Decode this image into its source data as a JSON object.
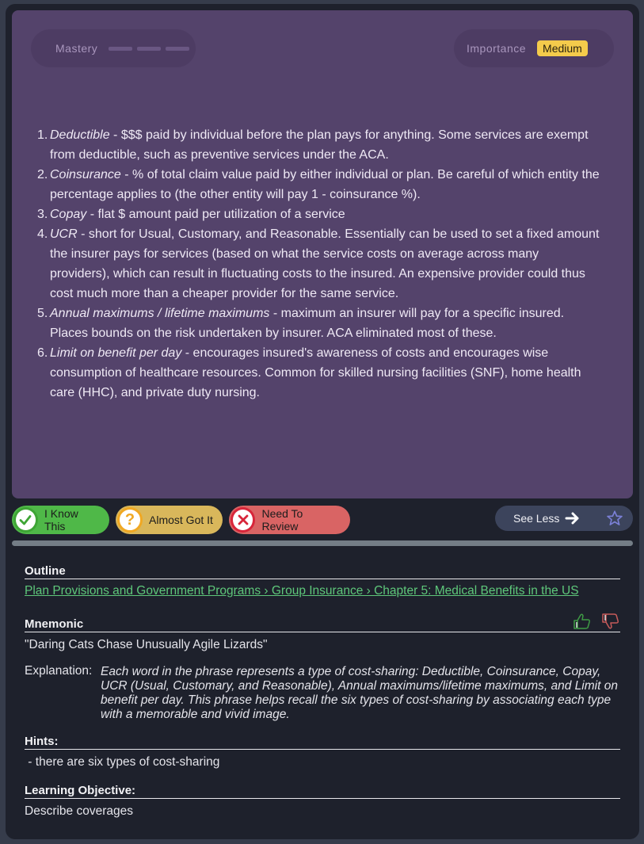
{
  "card": {
    "mastery_label": "Mastery",
    "mastery_level": 0,
    "mastery_segments": 3,
    "importance_label": "Importance",
    "importance_value": "Medium",
    "definitions": [
      {
        "term": "Deductible",
        "text": " - $$$ paid by individual before the plan pays for anything. Some services are exempt from deductible, such as preventive services under the ACA."
      },
      {
        "term": "Coinsurance",
        "text": " - % of total claim value paid by either individual or plan. Be careful of which entity the percentage applies to (the other entity will pay 1 - coinsurance %)."
      },
      {
        "term": "Copay",
        "text": " - flat $ amount paid per utilization of a service"
      },
      {
        "term": "UCR",
        "text": " - short for Usual, Customary, and Reasonable. Essentially can be used to set a fixed amount the insurer pays for services (based on what the service costs on average across many providers), which can result in fluctuating costs to the insured. An expensive provider could thus cost much more than a cheaper provider for the same service."
      },
      {
        "term": "Annual maximums / lifetime maximums",
        "text": " - maximum an insurer will pay for a specific insured. Places bounds on the risk undertaken by insurer. ACA eliminated most of these."
      },
      {
        "term": "Limit on benefit per day",
        "text": " - encourages insured's awareness of costs and encourages wise consumption of healthcare resources. Common for skilled nursing facilities (SNF), home health care (HHC), and private duty nursing."
      }
    ]
  },
  "actions": {
    "know_label": "I Know This",
    "know_icon": "check-icon",
    "almost_label": "Almost Got It",
    "almost_icon": "question-icon",
    "review_label": "Need To Review",
    "review_icon": "x-icon",
    "see_less_label": "See Less",
    "favorite_icon": "star-icon"
  },
  "colors": {
    "card_bg": "#54436b",
    "know": "#4fb848",
    "almost": "#d9b75b",
    "review": "#d96464",
    "importance_badge": "#f4cb4b",
    "link": "#5ec77a"
  },
  "details": {
    "outline_heading": "Outline",
    "outline_path": "Plan Provisions and Government Programs › Group Insurance › Chapter 5: Medical Benefits in the US",
    "mnemonic_heading": "Mnemonic",
    "mnemonic_text": "\"Daring Cats Chase Unusually Agile Lizards\"",
    "explanation_label": "Explanation:",
    "explanation_text": "Each word in the phrase represents a type of cost-sharing: Deductible, Coinsurance, Copay, UCR (Usual, Customary, and Reasonable), Annual maximums/lifetime maximums, and Limit on benefit per day. This phrase helps recall the six types of cost-sharing by associating each type with a memorable and vivid image.",
    "hints_heading": "Hints:",
    "hint_text": " - there are six types of cost-sharing",
    "objective_heading": "Learning Objective:",
    "objective_text": "Describe coverages"
  }
}
